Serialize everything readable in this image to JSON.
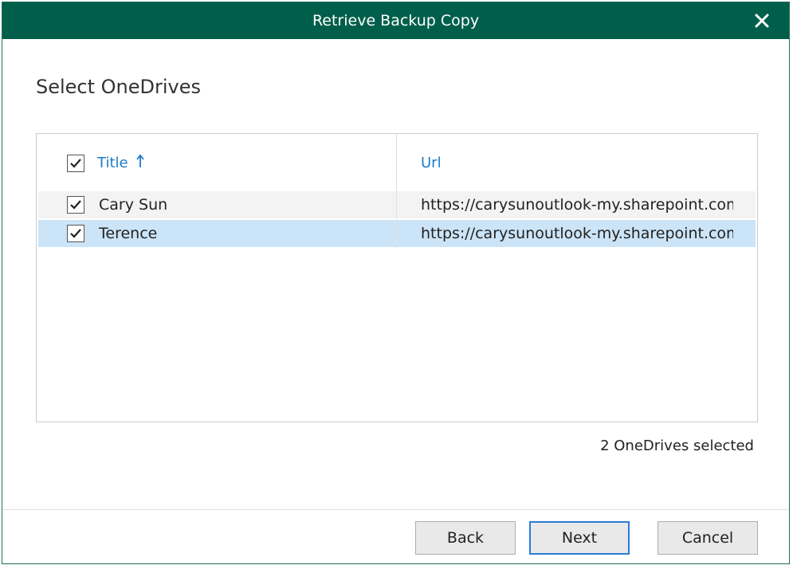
{
  "dialog": {
    "title": "Retrieve Backup Copy",
    "close_icon": "close-icon",
    "heading": "Select OneDrives"
  },
  "grid": {
    "columns": [
      {
        "label": "Title",
        "sort": "ascending",
        "sort_icon": "sort-up-arrow-icon"
      },
      {
        "label": "Url"
      }
    ],
    "header_checked": true,
    "rows": [
      {
        "title": "Cary Sun",
        "url": "https://carysunoutlook-my.sharepoint.com/",
        "checked": true,
        "selected": false
      },
      {
        "title": "Terence",
        "url": "https://carysunoutlook-my.sharepoint.com/",
        "checked": true,
        "selected": true
      }
    ]
  },
  "status": "2 OneDrives selected",
  "buttons": {
    "back": "Back",
    "next": "Next",
    "cancel": "Cancel"
  },
  "colors": {
    "titlebar": "#005f4b",
    "header_text": "#1e7bc8",
    "selected_row": "#cce4f7",
    "primary_border": "#2c7bd6"
  }
}
